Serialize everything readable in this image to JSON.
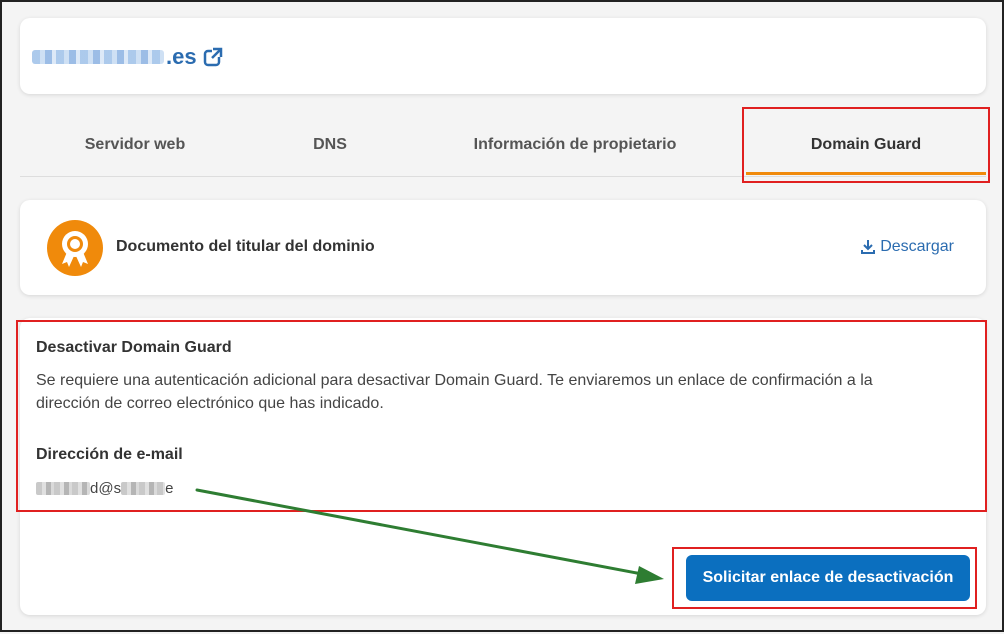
{
  "domain": {
    "tld": ".es"
  },
  "tabs": [
    {
      "label": "Servidor web"
    },
    {
      "label": "DNS"
    },
    {
      "label": "Información de propietario"
    },
    {
      "label": "Domain Guard"
    }
  ],
  "document": {
    "title": "Documento del titular del dominio",
    "download_label": "Descargar"
  },
  "deactivate": {
    "title": "Desactivar Domain Guard",
    "description": "Se requiere una autenticación adicional para desactivar Domain Guard. Te enviaremos un enlace de confirmación a la dirección de correo electrónico que has indicado.",
    "email_label": "Dirección de e-mail",
    "email_fragment_1": "d@s",
    "email_fragment_2": "e"
  },
  "action": {
    "button_label": "Solicitar enlace de desactivación"
  },
  "colors": {
    "accent": "#f08a0b",
    "primary": "#0b6fbf",
    "link": "#2b6cb0",
    "highlight": "#e02020",
    "arrow": "#2e7d32"
  }
}
